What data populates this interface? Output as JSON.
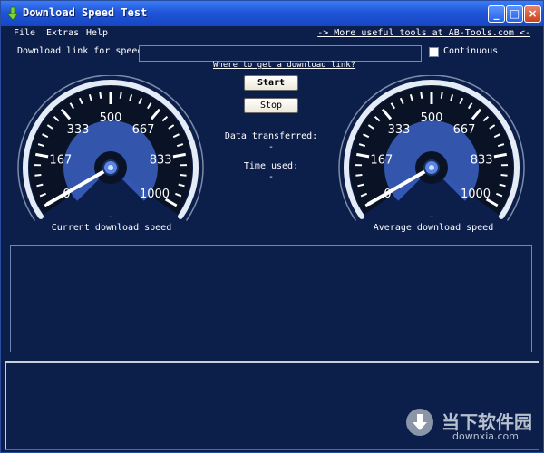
{
  "window": {
    "title": "Download Speed Test"
  },
  "titlebar_buttons": {
    "minimize": "_",
    "maximize": "□",
    "close": "×"
  },
  "menu": [
    "File",
    "Extras",
    "Help"
  ],
  "tools_link": "-> More useful tools at AB-Tools.com <-",
  "download": {
    "label": "Download link for speed",
    "value": ""
  },
  "continuous": {
    "label": "Continuous",
    "checked": false
  },
  "where_link": "Where to get a download link?",
  "buttons": {
    "start": "Start",
    "stop": "Stop"
  },
  "info": {
    "data_label": "Data transferred:",
    "data_value": "-",
    "time_label": "Time used:",
    "time_value": "-"
  },
  "gauges": [
    {
      "label": "Current download speed",
      "value_text": "-",
      "ticks": [
        "0",
        "167",
        "333",
        "500",
        "667",
        "833",
        "1000"
      ]
    },
    {
      "label": "Average download speed",
      "value_text": "-",
      "ticks": [
        "0",
        "167",
        "333",
        "500",
        "667",
        "833",
        "1000"
      ]
    }
  ],
  "watermark": {
    "text": "当下软件园",
    "url": "downxia.com"
  },
  "colors": {
    "background": "#0c1e4a",
    "titlebar": "#1f55d8",
    "gauge_face": "#0a1226",
    "gauge_arc": "#3b62c4"
  },
  "icons": {
    "app": "download-arrow-icon"
  }
}
